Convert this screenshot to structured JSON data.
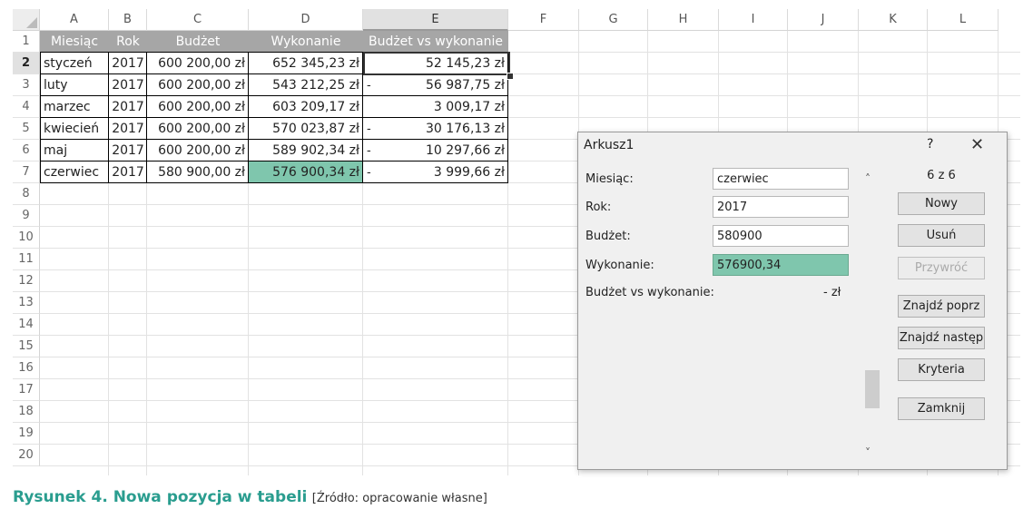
{
  "sheet": {
    "columns": [
      "A",
      "B",
      "C",
      "D",
      "E",
      "F",
      "G",
      "H",
      "I",
      "J",
      "K",
      "L"
    ],
    "rows": [
      "1",
      "2",
      "3",
      "4",
      "5",
      "6",
      "7",
      "8",
      "9",
      "10",
      "11",
      "12",
      "13",
      "14",
      "15",
      "16",
      "17",
      "18",
      "19",
      "20"
    ],
    "header": [
      "Miesiąc",
      "Rok",
      "Budżet",
      "Wykonanie",
      "Budżet vs wykonanie"
    ],
    "data": [
      [
        "styczeń",
        "2017",
        "600 200,00 zł",
        "652 345,23 zł",
        "",
        "52 145,23 zł"
      ],
      [
        "luty",
        "2017",
        "600 200,00 zł",
        "543 212,25 zł",
        "-",
        "56 987,75 zł"
      ],
      [
        "marzec",
        "2017",
        "600 200,00 zł",
        "603 209,17 zł",
        "",
        "3 009,17 zł"
      ],
      [
        "kwiecień",
        "2017",
        "600 200,00 zł",
        "570 023,87 zł",
        "-",
        "30 176,13 zł"
      ],
      [
        "maj",
        "2017",
        "600 200,00 zł",
        "589 902,34 zł",
        "-",
        "10 297,66 zł"
      ],
      [
        "czerwiec",
        "2017",
        "580 900,00 zł",
        "576 900,34 zł",
        "-",
        "3 999,66 zł"
      ]
    ],
    "header_color": "#a6a6a6",
    "highlight_color": "#7fc6ad"
  },
  "dialog": {
    "title": "Arkusz1",
    "help": "?",
    "close": "✕",
    "fields": [
      {
        "label": "Miesiąc:",
        "value": "czerwiec"
      },
      {
        "label": "Rok:",
        "value": "2017"
      },
      {
        "label": "Budżet:",
        "value": "580900"
      },
      {
        "label": "Wykonanie:",
        "value": "576900,34"
      }
    ],
    "calc_label": "Budżet vs wykonanie:",
    "calc_value": "-  zł",
    "counter": "6 z 6",
    "scroll_up": "˄",
    "scroll_down": "˅",
    "buttons": {
      "new": "Nowy",
      "delete": "Usuń",
      "restore": "Przywróć",
      "find_prev": "Znajdź poprz",
      "find_next": "Znajdź następ",
      "criteria": "Kryteria",
      "close": "Zamknij"
    }
  },
  "caption": {
    "main": "Rysunek 4. Nowa pozycja w tabeli",
    "source": "[Źródło: opracowanie własne]"
  }
}
